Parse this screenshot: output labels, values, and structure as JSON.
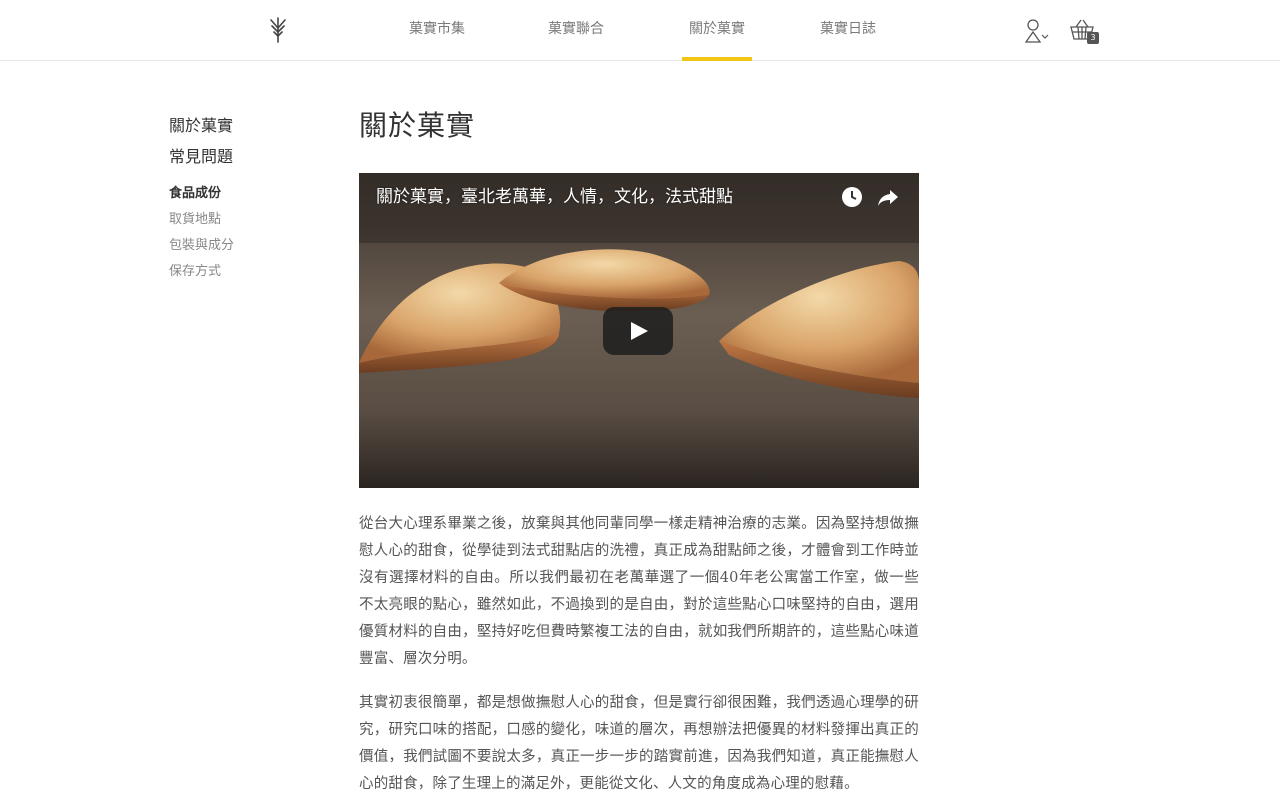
{
  "header": {
    "nav": [
      {
        "label": "菓實市集"
      },
      {
        "label": "菓實聯合"
      },
      {
        "label": "關於菓實",
        "active": true
      },
      {
        "label": "菓實日誌"
      }
    ],
    "cart_count": "3",
    "accent_color": "#f2c416"
  },
  "sidebar": {
    "main_items": [
      {
        "label": "關於菓實"
      },
      {
        "label": "常見問題"
      }
    ],
    "sub_items": [
      {
        "label": "食品成份",
        "active": true
      },
      {
        "label": "取貨地點"
      },
      {
        "label": "包裝與成分"
      },
      {
        "label": "保存方式"
      }
    ]
  },
  "main": {
    "title": "關於菓實",
    "video": {
      "title": "關於菓實，臺北老萬華，人情，文化，法式甜點",
      "icons": [
        "watch-later-icon",
        "share-icon",
        "play-icon"
      ]
    },
    "paragraphs": [
      "從台大心理系畢業之後，放棄與其他同輩同學一樣走精神治療的志業。因為堅持想做撫慰人心的甜食，從學徒到法式甜點店的洗禮，真正成為甜點師之後，才體會到工作時並沒有選擇材料的自由。所以我們最初在老萬華選了一個40年老公寓當工作室，做一些不太亮眼的點心，雖然如此，不過換到的是自由，對於這些點心口味堅持的自由，選用優質材料的自由，堅持好吃但費時繁複工法的自由，就如我們所期許的，這些點心味道豐富、層次分明。",
      "其實初衷很簡單，都是想做撫慰人心的甜食，但是實行卻很困難，我們透過心理學的研究，研究口味的搭配，口感的變化，味道的層次，再想辦法把優異的材料發揮出真正的價值，我們試圖不要說太多，真正一步一步的踏實前進，因為我們知道，真正能撫慰人心的甜食，除了生理上的滿足外，更能從文化、人文的角度成為心理的慰藉。"
    ]
  }
}
